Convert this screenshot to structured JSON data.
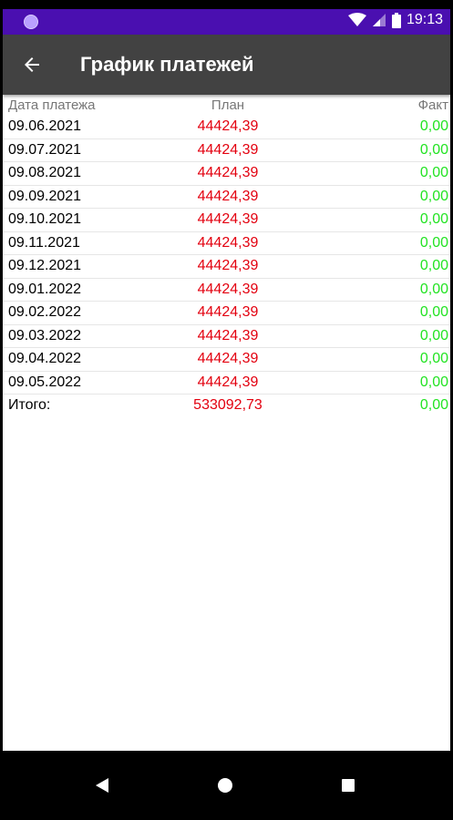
{
  "status_bar": {
    "time": "19:13",
    "color": "#4a0fb0"
  },
  "app_bar": {
    "title": "График платежей",
    "back_icon": "arrow-back-icon",
    "color": "#424242"
  },
  "table": {
    "headers": [
      "Дата платежа",
      "План",
      "Факт"
    ],
    "rows": [
      {
        "date": "09.06.2021",
        "plan": "44424,39",
        "fact": "0,00"
      },
      {
        "date": "09.07.2021",
        "plan": "44424,39",
        "fact": "0,00"
      },
      {
        "date": "09.08.2021",
        "plan": "44424,39",
        "fact": "0,00"
      },
      {
        "date": "09.09.2021",
        "plan": "44424,39",
        "fact": "0,00"
      },
      {
        "date": "09.10.2021",
        "plan": "44424,39",
        "fact": "0,00"
      },
      {
        "date": "09.11.2021",
        "plan": "44424,39",
        "fact": "0,00"
      },
      {
        "date": "09.12.2021",
        "plan": "44424,39",
        "fact": "0,00"
      },
      {
        "date": "09.01.2022",
        "plan": "44424,39",
        "fact": "0,00"
      },
      {
        "date": "09.02.2022",
        "plan": "44424,39",
        "fact": "0,00"
      },
      {
        "date": "09.03.2022",
        "plan": "44424,39",
        "fact": "0,00"
      },
      {
        "date": "09.04.2022",
        "plan": "44424,39",
        "fact": "0,00"
      },
      {
        "date": "09.05.2022",
        "plan": "44424,39",
        "fact": "0,00"
      }
    ],
    "total": {
      "label": "Итого:",
      "plan": "533092,73",
      "fact": "0,00"
    },
    "colors": {
      "plan": "#e3000f",
      "fact": "#22e322"
    }
  },
  "nav_bar": {
    "icons": [
      "back-triangle-icon",
      "home-circle-icon",
      "recents-square-icon"
    ]
  }
}
